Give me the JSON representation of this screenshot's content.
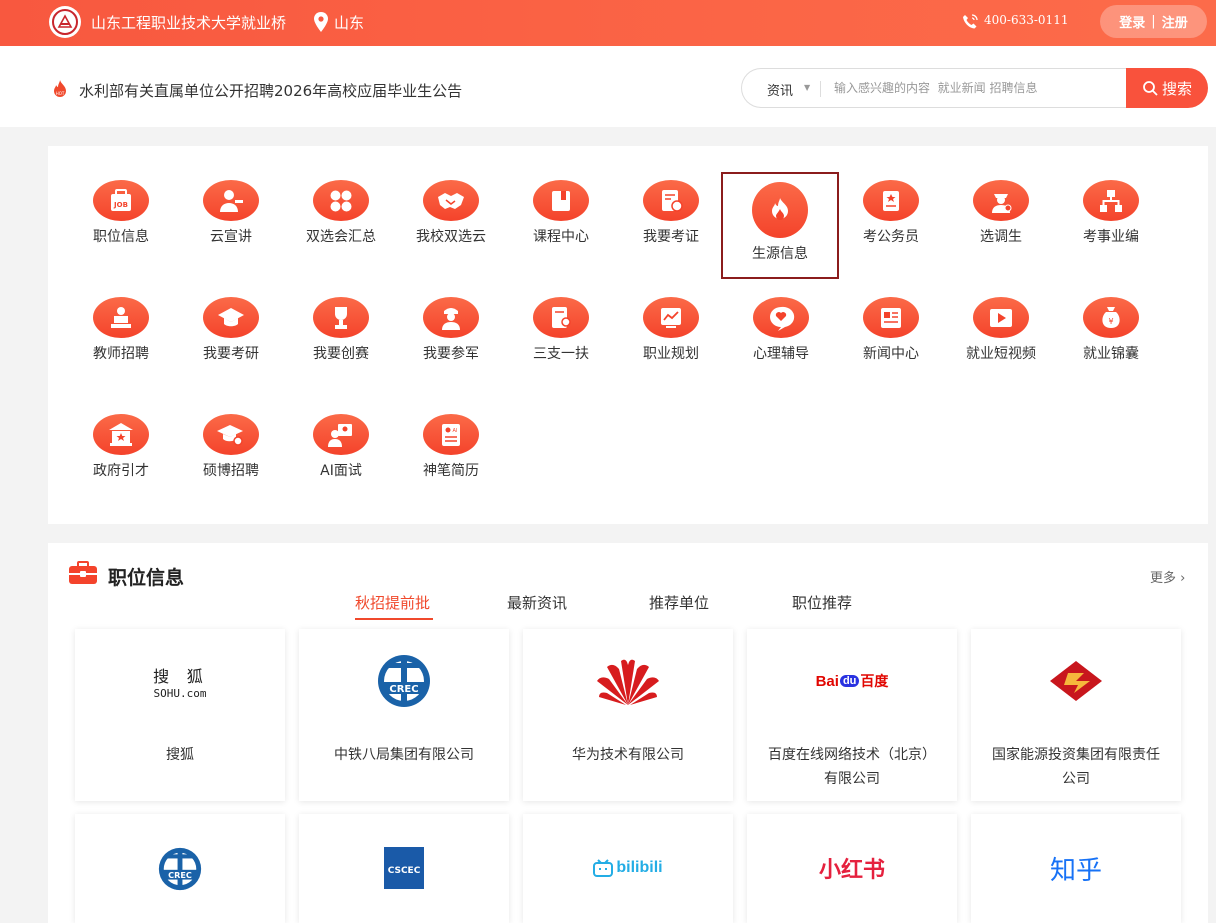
{
  "topbar": {
    "site_name": "山东工程职业技术大学就业桥",
    "location": "山东",
    "phone": "400-633-0111",
    "login": "登录",
    "separator": "|",
    "register": "注册"
  },
  "notice": {
    "text": "水利部有关直属单位公开招聘2026年高校应届毕业生公告"
  },
  "search": {
    "type": "资讯",
    "placeholder": "输入感兴趣的内容  就业新闻 招聘信息",
    "button": "搜索"
  },
  "services": [
    {
      "label": "职位信息",
      "icon": "job-icon"
    },
    {
      "label": "云宣讲",
      "icon": "presenter-icon"
    },
    {
      "label": "双选会汇总",
      "icon": "clover-icon"
    },
    {
      "label": "我校双选云",
      "icon": "handshake-icon"
    },
    {
      "label": "课程中心",
      "icon": "book-icon"
    },
    {
      "label": "我要考证",
      "icon": "certificate-icon"
    },
    {
      "label": "生源信息",
      "icon": "flame-icon",
      "active": true
    },
    {
      "label": "考公务员",
      "icon": "badge-doc-icon"
    },
    {
      "label": "选调生",
      "icon": "officer-icon"
    },
    {
      "label": "考事业编",
      "icon": "org-chart-icon"
    },
    {
      "label": "教师招聘",
      "icon": "teacher-icon"
    },
    {
      "label": "我要考研",
      "icon": "graduation-cap-icon"
    },
    {
      "label": "我要创赛",
      "icon": "trophy-icon"
    },
    {
      "label": "我要参军",
      "icon": "soldier-icon"
    },
    {
      "label": "三支一扶",
      "icon": "document-user-icon"
    },
    {
      "label": "职业规划",
      "icon": "chart-board-icon"
    },
    {
      "label": "心理辅导",
      "icon": "heart-chat-icon"
    },
    {
      "label": "新闻中心",
      "icon": "newspaper-icon"
    },
    {
      "label": "就业短视频",
      "icon": "video-icon"
    },
    {
      "label": "就业锦囊",
      "icon": "money-bag-icon"
    },
    {
      "label": "政府引才",
      "icon": "government-icon"
    },
    {
      "label": "硕博招聘",
      "icon": "doctor-cap-icon"
    },
    {
      "label": "AI面试",
      "icon": "ai-interview-icon"
    },
    {
      "label": "神笔简历",
      "icon": "resume-icon"
    }
  ],
  "jobs": {
    "title": "职位信息",
    "more": "更多",
    "tabs": [
      "秋招提前批",
      "最新资讯",
      "推荐单位",
      "职位推荐"
    ],
    "active_tab": 0,
    "companies": [
      {
        "name": "搜狐",
        "logo": "sohu-logo",
        "logo_text_top": "搜  狐",
        "logo_text_bottom": "SOHU.com"
      },
      {
        "name": "中铁八局集团有限公司",
        "logo": "crec-logo",
        "logo_text": "CREC"
      },
      {
        "name": "华为技术有限公司",
        "logo": "huawei-logo"
      },
      {
        "name": "百度在线网络技术（北京）有限公司",
        "logo": "baidu-logo",
        "logo_text": "Bai",
        "logo_text2": "du",
        "logo_text3": "百度"
      },
      {
        "name": "国家能源投资集团有限责任公司",
        "logo": "chn-energy-logo"
      },
      {
        "name": "",
        "logo": "crec-logo",
        "logo_text": "CREC"
      },
      {
        "name": "",
        "logo": "cscec-logo",
        "logo_text": "CSCEC"
      },
      {
        "name": "",
        "logo": "bilibili-logo",
        "logo_text": "bilibili"
      },
      {
        "name": "",
        "logo": "xiaohongshu-logo",
        "logo_text": "小红书"
      },
      {
        "name": "",
        "logo": "zhihu-logo",
        "logo_text": "知乎"
      }
    ]
  },
  "colors": {
    "brand": "#f9523c",
    "active_border": "#8b1c1c"
  }
}
